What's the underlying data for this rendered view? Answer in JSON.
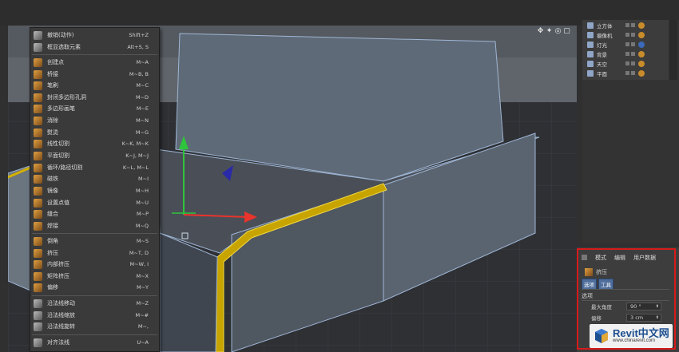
{
  "viewport_toolbar": {
    "icons": [
      "move-view-icon",
      "scroll-view-icon",
      "zoom-view-icon",
      "maximize-view-icon"
    ],
    "glyphs": [
      "✥",
      "✦",
      "◎",
      "▢"
    ]
  },
  "context_menu": {
    "items": [
      {
        "label": "撤销(动作)",
        "key": "Shift+Z",
        "icon": "undo-icon"
      },
      {
        "label": "框显选取元素",
        "key": "Alt+S, S",
        "icon": "frame-selection-icon"
      },
      {
        "label": "创建点",
        "key": "M~A",
        "icon": "create-point-icon"
      },
      {
        "label": "桥接",
        "key": "M~B, B",
        "icon": "bridge-icon"
      },
      {
        "label": "笔刷",
        "key": "M~C",
        "icon": "brush-icon"
      },
      {
        "label": "封闭多边形孔洞",
        "key": "M~D",
        "icon": "close-polygon-hole-icon"
      },
      {
        "label": "多边形画笔",
        "key": "M~E",
        "icon": "polygon-pen-icon"
      },
      {
        "label": "消除",
        "key": "M~N",
        "icon": "dissolve-icon"
      },
      {
        "label": "熨烫",
        "key": "M~G",
        "icon": "iron-icon"
      },
      {
        "label": "线性切割",
        "key": "K~K, M~K",
        "icon": "line-cut-icon"
      },
      {
        "label": "平面切割",
        "key": "K~J, M~J",
        "icon": "plane-cut-icon"
      },
      {
        "label": "循环/路径切割",
        "key": "K~L, M~L",
        "icon": "loop-path-cut-icon"
      },
      {
        "label": "磁铁",
        "key": "M~I",
        "icon": "magnet-icon"
      },
      {
        "label": "镜像",
        "key": "M~H",
        "icon": "mirror-icon"
      },
      {
        "label": "设置点值",
        "key": "M~U",
        "icon": "set-point-value-icon"
      },
      {
        "label": "缝合",
        "key": "M~P",
        "icon": "stitch-icon"
      },
      {
        "label": "焊接",
        "key": "M~Q",
        "icon": "weld-icon"
      },
      {
        "label": "倒角",
        "key": "M~S",
        "icon": "bevel-icon"
      },
      {
        "label": "挤压",
        "key": "M~T, D",
        "icon": "extrude-icon"
      },
      {
        "label": "内部挤压",
        "key": "M~W, I",
        "icon": "extrude-inner-icon"
      },
      {
        "label": "矩阵挤压",
        "key": "M~X",
        "icon": "matrix-extrude-icon"
      },
      {
        "label": "偏移",
        "key": "M~Y",
        "icon": "smooth-shift-icon"
      },
      {
        "label": "沿法线移动",
        "key": "M~Z",
        "icon": "normal-move-icon"
      },
      {
        "label": "沿法线缩放",
        "key": "M~#",
        "icon": "normal-scale-icon"
      },
      {
        "label": "沿法线旋转",
        "key": "M~,",
        "icon": "normal-rotate-icon"
      },
      {
        "label": "对齐法线",
        "key": "U~A",
        "icon": "align-normals-icon"
      }
    ]
  },
  "object_manager": {
    "items": [
      {
        "name": "立方体",
        "icon": "cube-object-icon"
      },
      {
        "name": "摄像机",
        "icon": "camera-object-icon"
      },
      {
        "name": "灯光",
        "icon": "light-object-icon"
      },
      {
        "name": "背景",
        "icon": "background-object-icon"
      },
      {
        "name": "天空",
        "icon": "sky-object-icon"
      },
      {
        "name": "平面",
        "icon": "plane-object-icon"
      }
    ]
  },
  "attributes": {
    "tabs": [
      "模式",
      "编辑",
      "用户数据"
    ],
    "object_name": "挤压",
    "subtabs": [
      "选项",
      "工具"
    ],
    "section": "选项",
    "fields": [
      {
        "label": "最大角度",
        "value": "90 °"
      },
      {
        "label": "偏移",
        "value": "3 cm"
      }
    ]
  },
  "watermark": {
    "brand": "Revit中文网",
    "url": "www.chinarevit.com"
  },
  "colors": {
    "highlight": "#d71a1a",
    "selection_edge": "#d4b000",
    "axis_y": "#2ec43c",
    "axis_x": "#e8342c",
    "axis_z": "#2a2aa8"
  }
}
